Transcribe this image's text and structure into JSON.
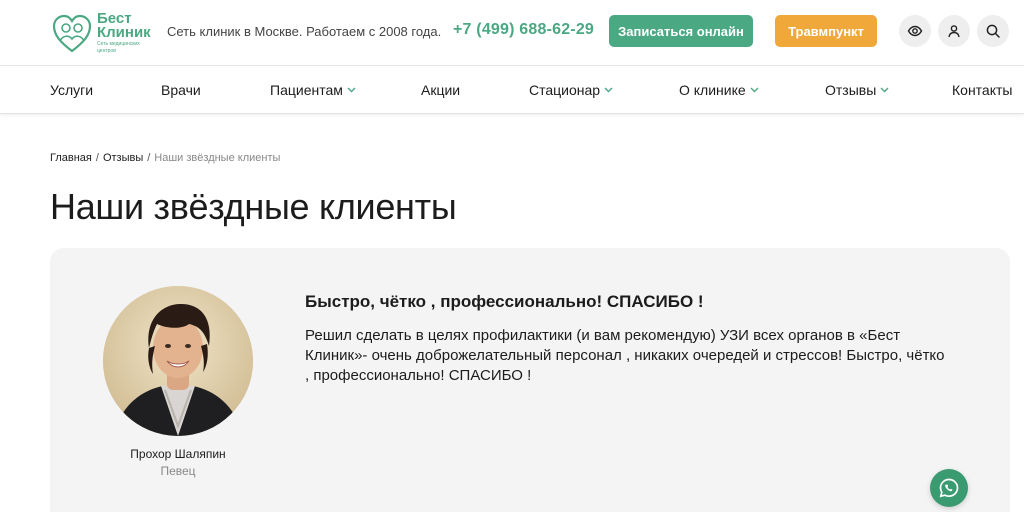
{
  "header": {
    "logo": {
      "name_line1": "Бест",
      "name_line2": "Клиник",
      "subtitle_line1": "Сеть медицинских",
      "subtitle_line2": "центров"
    },
    "tagline": "Сеть клиник в Москве. Работаем с 2008 года.",
    "phone": "+7 (499) 688-62-29",
    "online_button": "Записаться онлайн",
    "trauma_button": "Травмпункт",
    "icons": [
      "eye-icon",
      "user-icon",
      "search-icon"
    ]
  },
  "nav": {
    "items": [
      {
        "label": "Услуги",
        "dropdown": false
      },
      {
        "label": "Врачи",
        "dropdown": false
      },
      {
        "label": "Пациентам",
        "dropdown": true
      },
      {
        "label": "Акции",
        "dropdown": false
      },
      {
        "label": "Стационар",
        "dropdown": true
      },
      {
        "label": "О клинике",
        "dropdown": true
      },
      {
        "label": "Отзывы",
        "dropdown": true
      },
      {
        "label": "Контакты",
        "dropdown": false
      }
    ]
  },
  "breadcrumb": {
    "items": [
      "Главная",
      "Отзывы",
      "Наши звёздные клиенты"
    ],
    "separator": "/"
  },
  "page_title": "Наши звёздные клиенты",
  "review": {
    "person_name": "Прохор Шаляпин",
    "person_role": "Певец",
    "title": "Быстро, чётко , профессионально! СПАСИБО !",
    "text": "Решил сделать в целях профилактики (и вам рекомендую) УЗИ всех органов в «Бест Клиник»- очень доброжелательный персонал , никаких очередей и стрессов! Быстро, чётко , профессионально! СПАСИБО !"
  },
  "colors": {
    "accent_green": "#4aa883",
    "accent_orange": "#f0a83b",
    "card_bg": "#f4f4f5",
    "whatsapp_green": "#3a9b70"
  }
}
